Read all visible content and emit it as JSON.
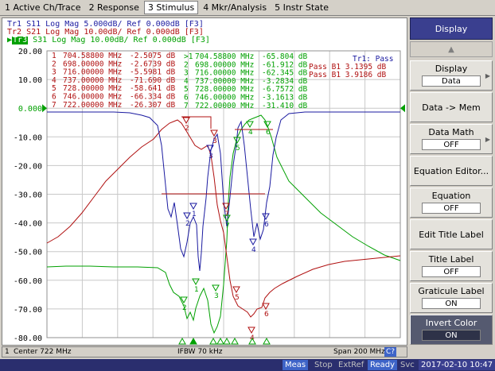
{
  "menu": [
    "1 Active Ch/Trace",
    "2 Response",
    "3 Stimulus",
    "4 Mkr/Analysis",
    "5 Instr State"
  ],
  "traces": [
    {
      "id": "Tr1",
      "text": "Tr1 S11 Log Mag 5.000dB/ Ref 0.000dB [F3]",
      "color": "#1a1aa0"
    },
    {
      "id": "Tr2",
      "text": "Tr2 S21 Log Mag 10.00dB/ Ref 0.000dB [F3]",
      "color": "#b01010"
    },
    {
      "id": "Tr3",
      "text": "S31 Log Mag 10.00dB/ Ref 0.000dB [F3]",
      "label": "Tr3",
      "color": "#00a000"
    }
  ],
  "y_ticks": [
    "20.00",
    "10.00",
    "0.000",
    "-10.00",
    "-20.00",
    "-30.00",
    "-40.00",
    "-50.00",
    "-60.00",
    "-70.00",
    "-80.00"
  ],
  "marker_table_tr2": [
    {
      "n": "1",
      "freq": "704.58800 MHz",
      "val": "-2.5075 dB"
    },
    {
      "n": "2",
      "freq": "698.00000 MHz",
      "val": "-2.6739 dB"
    },
    {
      "n": "3",
      "freq": "716.00000 MHz",
      "val": "-5.5981 dB"
    },
    {
      "n": "4",
      "freq": "737.00000 MHz",
      "val": "-71.690 dB"
    },
    {
      "n": "5",
      "freq": "728.00000 MHz",
      "val": "-58.641 dB"
    },
    {
      "n": "6",
      "freq": "746.00000 MHz",
      "val": "-66.334 dB"
    },
    {
      "n": "7",
      "freq": "722.00000 MHz",
      "val": "-26.307 dB"
    }
  ],
  "marker_table_tr3": [
    {
      "n": ">1",
      "freq": "704.58800 MHz",
      "val": "-65.804 dB"
    },
    {
      "n": "2",
      "freq": "698.00000 MHz",
      "val": "-61.912 dB"
    },
    {
      "n": "3",
      "freq": "716.00000 MHz",
      "val": "-62.345 dB"
    },
    {
      "n": "4",
      "freq": "737.00000 MHz",
      "val": "-3.2834 dB"
    },
    {
      "n": "5",
      "freq": "728.00000 MHz",
      "val": "-6.7572 dB"
    },
    {
      "n": "6",
      "freq": "746.00000 MHz",
      "val": "-3.1613 dB"
    },
    {
      "n": "7",
      "freq": "722.00000 MHz",
      "val": "-31.410 dB"
    }
  ],
  "pass_fail": {
    "title": "Tr1: Pass",
    "rows": [
      "Pass B1  3.1395 dB",
      "Pass B1  3.9186 dB"
    ]
  },
  "channel_status": {
    "channel": "1",
    "center": "Center 722 MHz",
    "ifbw": "IFBW 70 kHz",
    "span": "Span 200 MHz",
    "cal": "C?"
  },
  "softkeys": {
    "title": "Display",
    "items": [
      {
        "label": "Display",
        "value": "Data"
      },
      {
        "label": "Data -> Mem"
      },
      {
        "label": "Data Math",
        "value": "OFF"
      },
      {
        "label": "Equation Editor..."
      },
      {
        "label": "Equation",
        "value": "OFF"
      },
      {
        "label": "Edit Title Label"
      },
      {
        "label": "Title Label",
        "value": "OFF"
      },
      {
        "label": "Graticule Label",
        "value": "ON"
      },
      {
        "label": "Invert Color",
        "value": "ON"
      }
    ]
  },
  "instrument_status": {
    "meas": "Meas",
    "stop": "Stop",
    "extref": "ExtRef",
    "ready": "Ready",
    "svc": "Svc",
    "datetime": "2017-02-10 10:47"
  },
  "colors": {
    "s11": "#1a1aa0",
    "s21": "#b01010",
    "s31": "#00a000",
    "grid": "#c8c8c8"
  }
}
